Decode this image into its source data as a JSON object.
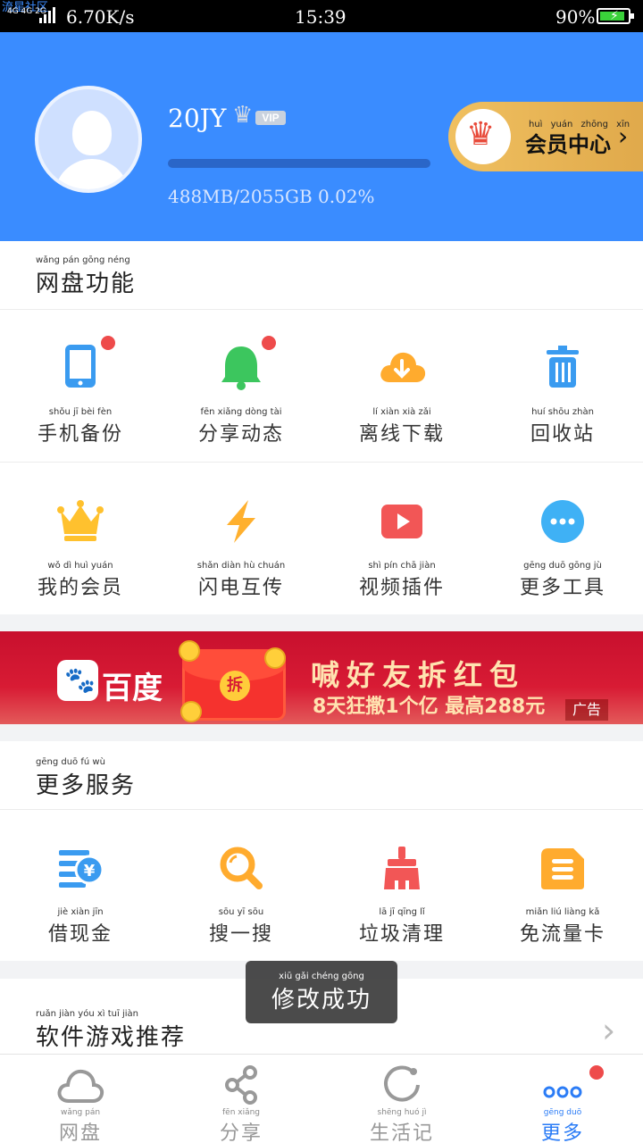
{
  "status_bar": {
    "watermark": "流星社区",
    "signal": "4G 4G 2G",
    "speed": "6.70K/s",
    "time": "15:39",
    "battery": "90%",
    "battery_level": 0.9
  },
  "profile": {
    "username": "20JY",
    "vip_tag": "VIP",
    "quota_text": "488MB/2055GB 0.02%",
    "quota_fraction": 0.0002,
    "member_center": {
      "pinyin": "huì yuán zhōng xīn",
      "label": "会员中心"
    }
  },
  "netdisk_section": {
    "title_pinyin": "wǎng pán gōng néng",
    "title": "网盘功能",
    "items": [
      {
        "pinyin": "shǒu jī bèi fèn",
        "label": "手机备份",
        "icon": "phone-icon",
        "color": "#3a9bf0",
        "badge": true
      },
      {
        "pinyin": "fēn xiǎng dòng tài",
        "label": "分享动态",
        "icon": "bell-icon",
        "color": "#3cc65e",
        "badge": true
      },
      {
        "pinyin": "lí xiàn xià zǎi",
        "label": "离线下载",
        "icon": "cloud-download-icon",
        "color": "#ffab2e",
        "badge": false
      },
      {
        "pinyin": "huí shōu zhàn",
        "label": "回收站",
        "icon": "trash-icon",
        "color": "#3a9bf0",
        "badge": false
      },
      {
        "pinyin": "wǒ dì huì yuán",
        "label": "我的会员",
        "icon": "crown-icon",
        "color": "#ffc12e",
        "badge": false
      },
      {
        "pinyin": "shǎn diàn hù chuán",
        "label": "闪电互传",
        "icon": "lightning-icon",
        "color": "#ffb02e",
        "badge": false
      },
      {
        "pinyin": "shì pín chā jiàn",
        "label": "视频插件",
        "icon": "video-play-icon",
        "color": "#f25656",
        "badge": false
      },
      {
        "pinyin": "gēng duō gōng jù",
        "label": "更多工具",
        "icon": "more-dots-icon",
        "color": "#3fb1f5",
        "badge": false
      }
    ]
  },
  "banner": {
    "brand": "百度",
    "envelope_seal": "拆",
    "headline": "喊好友拆红包",
    "subline": "8天狂撒1个亿 最高288元",
    "ad_tag": "广告"
  },
  "services_section": {
    "title_pinyin": "gēng duō fú wù",
    "title": "更多服务",
    "items": [
      {
        "pinyin": "jiè xiàn jīn",
        "label": "借现金",
        "icon": "cash-icon",
        "color": "#3a9bf0"
      },
      {
        "pinyin": "sōu yī sōu",
        "label": "搜一搜",
        "icon": "search-icon",
        "color": "#ffab2e"
      },
      {
        "pinyin": "lā jī qīng lǐ",
        "label": "垃圾清理",
        "icon": "broom-icon",
        "color": "#f25656"
      },
      {
        "pinyin": "miǎn liú liàng kǎ",
        "label": "免流量卡",
        "icon": "sim-card-icon",
        "color": "#ffab2e"
      }
    ]
  },
  "recommend": {
    "title_pinyin": "ruǎn jiàn yóu xì tuī jiàn",
    "title": "软件游戏推荐"
  },
  "toast": {
    "pinyin": "xiū gǎi chéng gōng",
    "text": "修改成功"
  },
  "bottom_nav": [
    {
      "pinyin": "wǎng pán",
      "label": "网盘",
      "icon": "cloud-icon",
      "active": false
    },
    {
      "pinyin": "fēn xiǎng",
      "label": "分享",
      "icon": "share-icon",
      "active": false
    },
    {
      "pinyin": "shēng huó jì",
      "label": "生活记",
      "icon": "life-ring-icon",
      "active": false
    },
    {
      "pinyin": "gēng duō",
      "label": "更多",
      "icon": "more-dots-icon",
      "active": true,
      "badge": true
    }
  ],
  "colors": {
    "header_blue": "#3a8cff",
    "accent_blue": "#2b7cf6",
    "badge_red": "#ee4b4b",
    "gold": "#e6b054"
  }
}
